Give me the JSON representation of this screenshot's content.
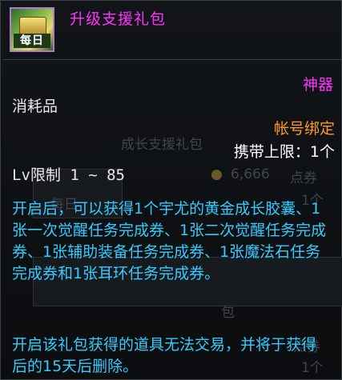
{
  "item": {
    "icon_label": "每日",
    "title": "升级支援礼包",
    "rarity": "神器",
    "category": "消耗品",
    "bind_type": "帐号绑定",
    "carry_limit": "携带上限：1个",
    "level_limit": "Lv限制 1 ~ 85",
    "description": "开启后，可以获得1个宇尤的黄金成长胶囊、1张一次觉醒任务完成券、1张二次觉醒任务完成券、1张辅助装备任务完成券、1张魔法石任务完成券和1张耳环任务完成券。",
    "note": "开启该礼包获得的道具无法交易，并将于获得后的15天后删除。"
  },
  "background": {
    "ghost_title": "成长支援礼包",
    "ghost_price": "6,666",
    "ghost_currency": "点券",
    "ghost_count": "1个",
    "ghost_daily": "每日",
    "ghost_sub": "包",
    "ghost_price2": "点券",
    "ghost_count2": "1个"
  },
  "colors": {
    "title": "#ff33ff",
    "rarity": "#ff33ff",
    "bind": "#ff9a1f",
    "description": "#33ccff",
    "text": "#e6e6e6"
  },
  "icons": [
    "gift-chest-icon",
    "coin-icon"
  ]
}
